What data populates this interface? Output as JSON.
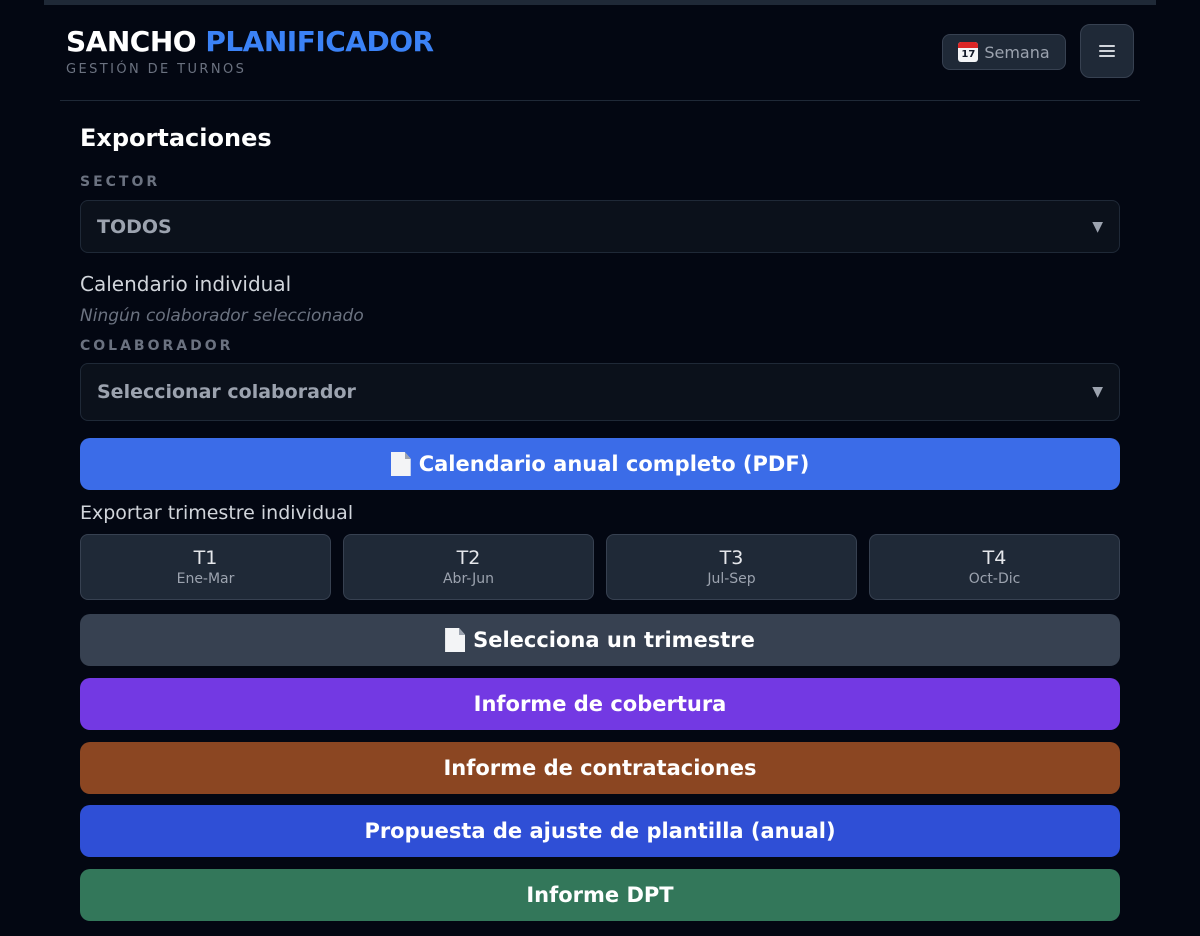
{
  "header": {
    "brand_part1": "SANCHO",
    "brand_part2": "PLANIFICADOR",
    "subtitle": "GESTIÓN DE TURNOS",
    "week_button_label": "Semana",
    "calendar_icon_day": "17"
  },
  "main": {
    "title": "Exportaciones",
    "sector": {
      "label": "SECTOR",
      "value": "TODOS"
    },
    "individual": {
      "heading": "Calendario individual",
      "hint": "Ningún colaborador seleccionado",
      "collaborator_label": "COLABORADOR",
      "collaborator_placeholder": "Seleccionar colaborador"
    },
    "annual_pdf_label": "Calendario anual completo (PDF)",
    "quarter_export": {
      "heading": "Exportar trimestre individual",
      "quarters": [
        {
          "name": "T1",
          "range": "Ene-Mar"
        },
        {
          "name": "T2",
          "range": "Abr-Jun"
        },
        {
          "name": "T3",
          "range": "Jul-Sep"
        },
        {
          "name": "T4",
          "range": "Oct-Dic"
        }
      ],
      "select_button_label": "Selecciona un trimestre"
    },
    "reports": {
      "coverage_label": "Informe de cobertura",
      "hiring_label": "Informe de contrataciones",
      "staff_adjust_label": "Propuesta de ajuste de plantilla (anual)",
      "dpt_label": "Informe DPT"
    }
  },
  "colors": {
    "background": "#030712",
    "accent_blue": "#3b82f6",
    "pdf_button": "#3b6ce8",
    "disabled_button": "#374151",
    "coverage_button": "#7339e3",
    "hiring_button": "#8b4622",
    "staff_adjust_button": "#2f4fd6",
    "dpt_button": "#33775a"
  }
}
